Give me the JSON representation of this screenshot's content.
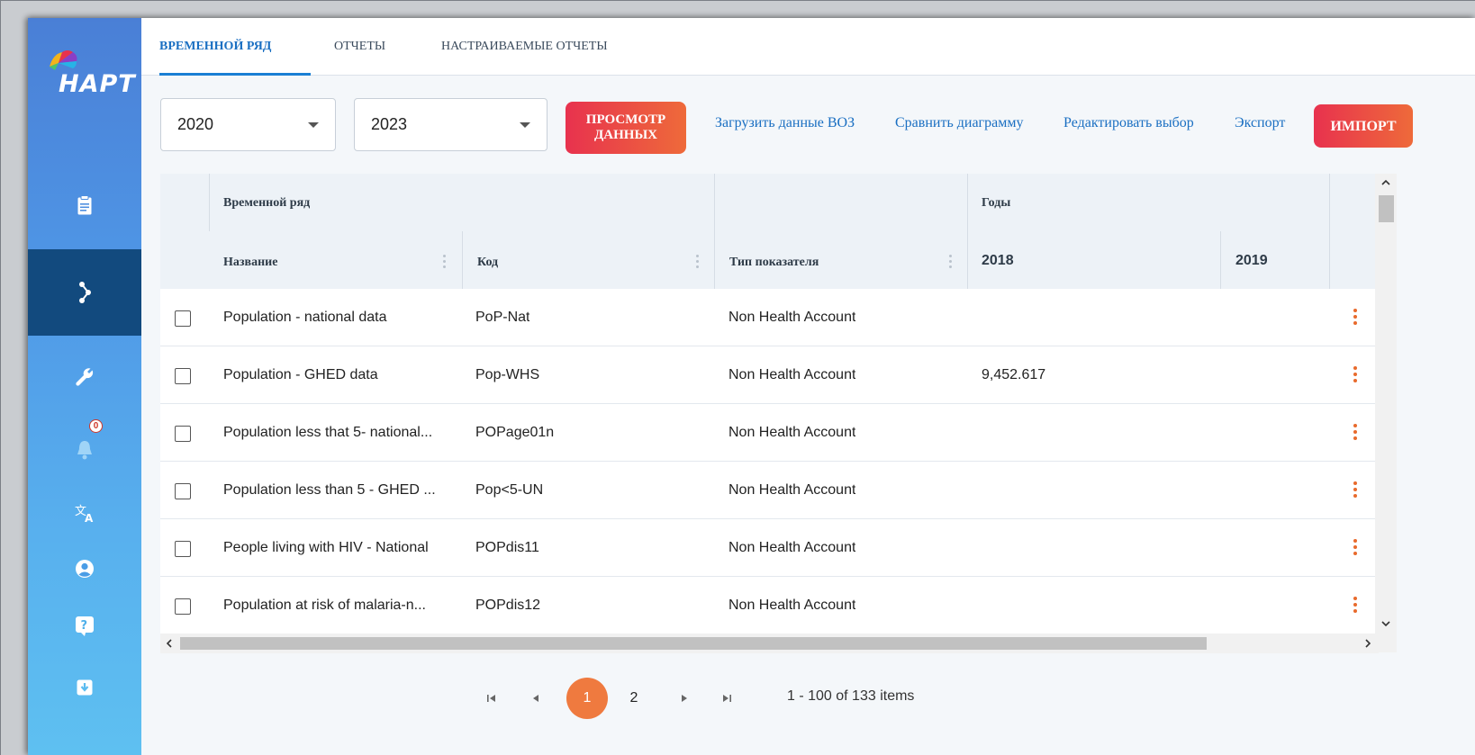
{
  "app": {
    "logo_text": "HAPT"
  },
  "tabs": [
    {
      "label": "ВРЕМЕННОЙ РЯД",
      "active": true
    },
    {
      "label": "ОТЧЕТЫ",
      "active": false
    },
    {
      "label": "НАСТРАИВАЕМЫЕ ОТЧЕТЫ",
      "active": false
    }
  ],
  "sidebar": {
    "notification_count": "0",
    "items": [
      {
        "icon": "clipboard-icon"
      },
      {
        "icon": "share-nodes-icon",
        "active": true
      },
      {
        "icon": "wrench-icon"
      },
      {
        "icon": "bell-icon"
      },
      {
        "icon": "translate-icon"
      },
      {
        "icon": "user-circle-icon"
      },
      {
        "icon": "help-icon"
      },
      {
        "icon": "download-icon"
      }
    ]
  },
  "toolbar": {
    "year_from": "2020",
    "year_to": "2023",
    "view_data_label_line1": "ПРОСМОТР",
    "view_data_label_line2": "ДАННЫХ",
    "links": [
      "Загрузить данные ВОЗ",
      "Сравнить диаграмму",
      "Редактировать выбор",
      "Экспорт"
    ],
    "import_label": "ИМПОРТ"
  },
  "grid": {
    "group_headers": {
      "timeseries": "Временной ряд",
      "years": "Годы"
    },
    "columns": {
      "name": "Название",
      "code": "Код",
      "type": "Тип показателя",
      "y2018": "2018",
      "y2019": "2019"
    },
    "rows": [
      {
        "name": "Population - national data",
        "code": "PoP-Nat",
        "type": "Non Health Account",
        "y2018": "",
        "y2019": ""
      },
      {
        "name": "Population - GHED data",
        "code": "Pop-WHS",
        "type": "Non Health Account",
        "y2018": "9,452.617",
        "y2019": ""
      },
      {
        "name": "Population less that 5- national...",
        "code": "POPage01n",
        "type": "Non Health Account",
        "y2018": "",
        "y2019": ""
      },
      {
        "name": "Population less than 5 - GHED ...",
        "code": "Pop<5-UN",
        "type": "Non Health Account",
        "y2018": "",
        "y2019": ""
      },
      {
        "name": "People living with HIV - National",
        "code": "POPdis11",
        "type": "Non Health Account",
        "y2018": "",
        "y2019": ""
      },
      {
        "name": "Population at risk of malaria-n...",
        "code": "POPdis12",
        "type": "Non Health Account",
        "y2018": "",
        "y2019": ""
      }
    ]
  },
  "pager": {
    "current_page": "1",
    "next_page": "2",
    "info": "1 - 100 of 133 items"
  },
  "colors": {
    "accent": "#1a6fc2",
    "brand_orange": "#ef7a3f",
    "sidebar_active": "#124a7e"
  }
}
